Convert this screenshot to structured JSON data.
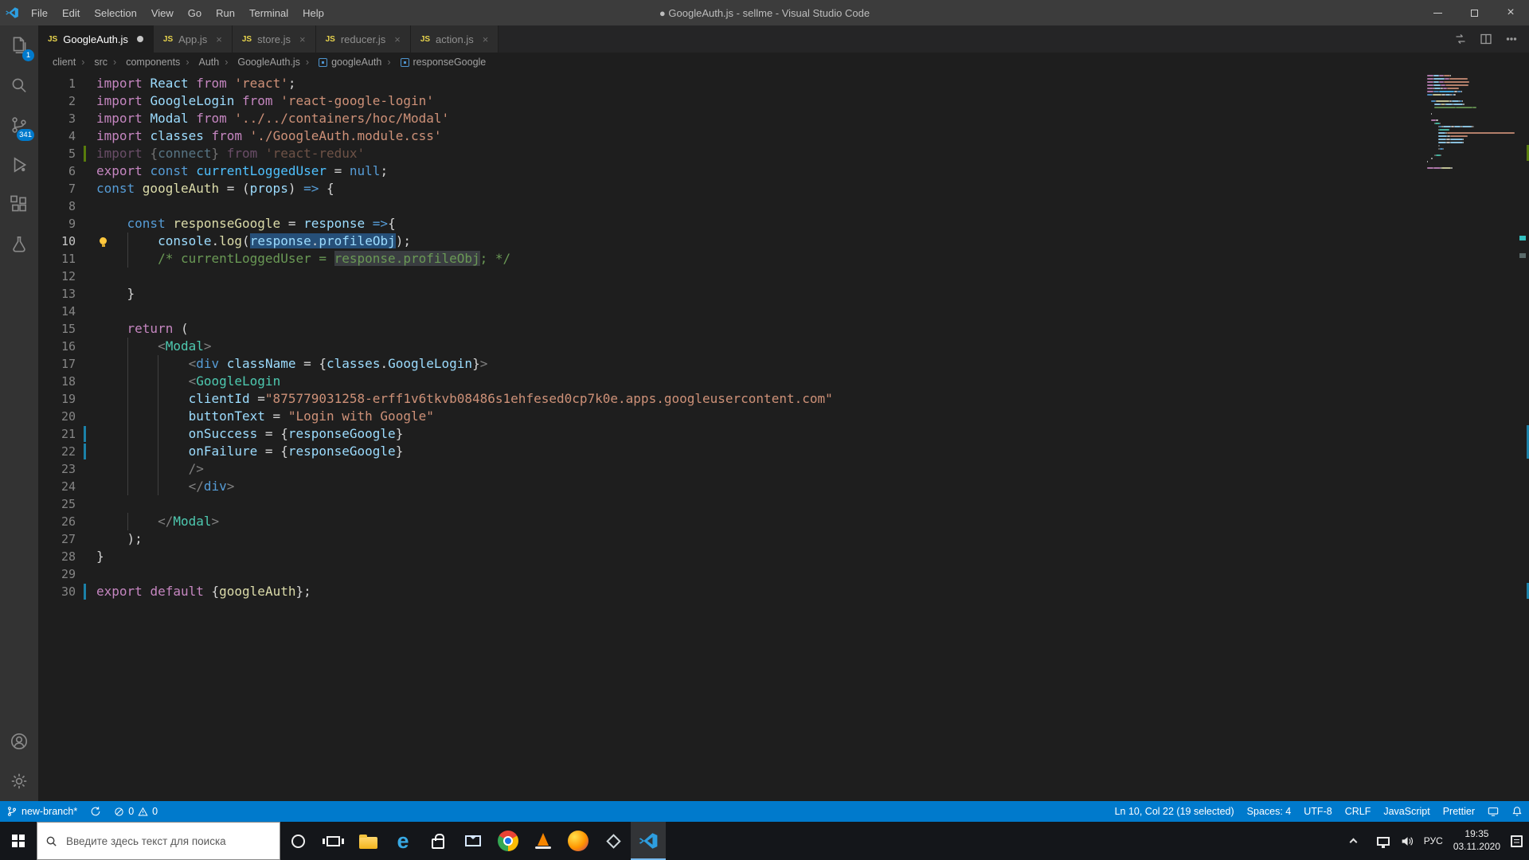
{
  "colors": {
    "accent": "#007acc",
    "selection": "#264f78",
    "match": "#3a3d41",
    "gut_mod": "#1b81a8",
    "gut_add": "#587c0c"
  },
  "titlebar": {
    "title": "● GoogleAuth.js - sellme - Visual Studio Code",
    "menus": [
      "File",
      "Edit",
      "Selection",
      "View",
      "Go",
      "Run",
      "Terminal",
      "Help"
    ]
  },
  "activitybar": {
    "explorer_badge": "1",
    "scm_badge": "341"
  },
  "tab_icon_text": "JS",
  "tabs": [
    {
      "label": "GoogleAuth.js"
    },
    {
      "label": "App.js"
    },
    {
      "label": "store.js"
    },
    {
      "label": "reducer.js"
    },
    {
      "label": "action.js"
    }
  ],
  "breadcrumb": {
    "items": [
      "client",
      "src",
      "components",
      "Auth",
      "GoogleAuth.js",
      "googleAuth",
      "responseGoogle"
    ]
  },
  "editor": {
    "palette": {
      "k": "#c586c0",
      "b": "#569cd6",
      "v": "#9cdcfe",
      "V": "#4fc1ff",
      "s": "#ce9178",
      "f": "#dcdcaa",
      "c": "#6a9955",
      "t": "#4ec9b0",
      "p": "#d4d4d4",
      "a": "#808080"
    },
    "lines": [
      {
        "t": [
          [
            "k",
            "import "
          ],
          [
            "v",
            "React "
          ],
          [
            "k",
            "from "
          ],
          [
            "s",
            "'react'"
          ],
          [
            "p",
            ";"
          ]
        ]
      },
      {
        "t": [
          [
            "k",
            "import "
          ],
          [
            "v",
            "GoogleLogin "
          ],
          [
            "k",
            "from "
          ],
          [
            "s",
            "'react-google-login'"
          ]
        ]
      },
      {
        "t": [
          [
            "k",
            "import "
          ],
          [
            "v",
            "Modal "
          ],
          [
            "k",
            "from "
          ],
          [
            "s",
            "'../../containers/hoc/Modal'"
          ]
        ]
      },
      {
        "t": [
          [
            "k",
            "import "
          ],
          [
            "v",
            "classes "
          ],
          [
            "k",
            "from "
          ],
          [
            "s",
            "'./GoogleAuth.module.css'"
          ]
        ]
      },
      {
        "d": true,
        "g": "a",
        "t": [
          [
            "k",
            "import "
          ],
          [
            "p",
            "{"
          ],
          [
            "v",
            "connect"
          ],
          [
            "p",
            "} "
          ],
          [
            "k",
            "from "
          ],
          [
            "s",
            "'react-redux'"
          ]
        ]
      },
      {
        "t": [
          [
            "k",
            "export "
          ],
          [
            "b",
            "const "
          ],
          [
            "V",
            "currentLoggedUser"
          ],
          [
            "p",
            " = "
          ],
          [
            "b",
            "null"
          ],
          [
            "p",
            ";"
          ]
        ]
      },
      {
        "t": [
          [
            "b",
            "const "
          ],
          [
            "f",
            "googleAuth"
          ],
          [
            "p",
            " = ("
          ],
          [
            "v",
            "props"
          ],
          [
            "p",
            ") "
          ],
          [
            "b",
            "=>"
          ],
          [
            "p",
            " {"
          ]
        ]
      },
      {
        "t": []
      },
      {
        "t": [
          [
            "i",
            "    "
          ],
          [
            "b",
            "const "
          ],
          [
            "f",
            "responseGoogle"
          ],
          [
            "p",
            " = "
          ],
          [
            "v",
            "response"
          ],
          [
            "p",
            " "
          ],
          [
            "b",
            "=>"
          ],
          [
            "p",
            "{"
          ]
        ]
      },
      {
        "cur": true,
        "lb": true,
        "t": [
          [
            "i",
            "    "
          ],
          [
            "i",
            "    "
          ],
          [
            "v",
            "console"
          ],
          [
            "p",
            "."
          ],
          [
            "f",
            "log"
          ],
          [
            "p",
            "("
          ],
          [
            "v",
            "response",
            "sel"
          ],
          [
            "p",
            ".",
            "sel"
          ],
          [
            "v",
            "profileObj",
            "sel"
          ],
          [
            "p",
            ");"
          ]
        ]
      },
      {
        "t": [
          [
            "i",
            "    "
          ],
          [
            "i",
            "    "
          ],
          [
            "c",
            "/* currentLoggedUser = "
          ],
          [
            "c",
            "response.profileObj",
            "hl"
          ],
          [
            "c",
            "; */"
          ]
        ]
      },
      {
        "t": []
      },
      {
        "t": [
          [
            "i",
            "    "
          ],
          [
            "p",
            "}"
          ]
        ]
      },
      {
        "t": []
      },
      {
        "t": [
          [
            "i",
            "    "
          ],
          [
            "k",
            "return"
          ],
          [
            "p",
            " ("
          ]
        ]
      },
      {
        "t": [
          [
            "i",
            "    "
          ],
          [
            "i",
            "    "
          ],
          [
            "a",
            "<"
          ],
          [
            "t",
            "Modal"
          ],
          [
            "a",
            ">"
          ]
        ]
      },
      {
        "t": [
          [
            "i",
            "    "
          ],
          [
            "i",
            "    "
          ],
          [
            "i",
            "    "
          ],
          [
            "a",
            "<"
          ],
          [
            "b",
            "div"
          ],
          [
            "p",
            " "
          ],
          [
            "v",
            "className"
          ],
          [
            "p",
            " = {"
          ],
          [
            "v",
            "classes"
          ],
          [
            "p",
            "."
          ],
          [
            "v",
            "GoogleLogin"
          ],
          [
            "p",
            "}"
          ],
          [
            "a",
            ">"
          ]
        ]
      },
      {
        "t": [
          [
            "i",
            "    "
          ],
          [
            "i",
            "    "
          ],
          [
            "i",
            "    "
          ],
          [
            "a",
            "<"
          ],
          [
            "t",
            "GoogleLogin"
          ]
        ]
      },
      {
        "t": [
          [
            "i",
            "    "
          ],
          [
            "i",
            "    "
          ],
          [
            "i",
            "    "
          ],
          [
            "v",
            "clientId"
          ],
          [
            "p",
            " ="
          ],
          [
            "s",
            "\"875779031258-erff1v6tkvb08486s1ehfesed0cp7k0e.apps.googleusercontent.com\""
          ]
        ]
      },
      {
        "t": [
          [
            "i",
            "    "
          ],
          [
            "i",
            "    "
          ],
          [
            "i",
            "    "
          ],
          [
            "v",
            "buttonText"
          ],
          [
            "p",
            " = "
          ],
          [
            "s",
            "\"Login with Google\""
          ]
        ]
      },
      {
        "g": "m",
        "t": [
          [
            "i",
            "    "
          ],
          [
            "i",
            "    "
          ],
          [
            "i",
            "    "
          ],
          [
            "v",
            "onSuccess"
          ],
          [
            "p",
            " = {"
          ],
          [
            "v",
            "responseGoogle"
          ],
          [
            "p",
            "}"
          ]
        ]
      },
      {
        "g": "m",
        "t": [
          [
            "i",
            "    "
          ],
          [
            "i",
            "    "
          ],
          [
            "i",
            "    "
          ],
          [
            "v",
            "onFailure"
          ],
          [
            "p",
            " = {"
          ],
          [
            "v",
            "responseGoogle"
          ],
          [
            "p",
            "}"
          ]
        ]
      },
      {
        "t": [
          [
            "i",
            "    "
          ],
          [
            "i",
            "    "
          ],
          [
            "i",
            "    "
          ],
          [
            "a",
            "/>"
          ]
        ]
      },
      {
        "t": [
          [
            "i",
            "    "
          ],
          [
            "i",
            "    "
          ],
          [
            "i",
            "    "
          ],
          [
            "a",
            "</"
          ],
          [
            "b",
            "div"
          ],
          [
            "a",
            ">"
          ]
        ]
      },
      {
        "t": []
      },
      {
        "t": [
          [
            "i",
            "    "
          ],
          [
            "i",
            "    "
          ],
          [
            "a",
            "</"
          ],
          [
            "t",
            "Modal"
          ],
          [
            "a",
            ">"
          ]
        ]
      },
      {
        "t": [
          [
            "i",
            "    "
          ],
          [
            "p",
            ");"
          ]
        ]
      },
      {
        "t": [
          [
            "p",
            "}"
          ]
        ]
      },
      {
        "t": []
      },
      {
        "g": "m",
        "t": [
          [
            "k",
            "export "
          ],
          [
            "k",
            "default "
          ],
          [
            "p",
            "{"
          ],
          [
            "f",
            "googleAuth"
          ],
          [
            "p",
            "};"
          ]
        ]
      }
    ]
  },
  "statusbar": {
    "branch": "new-branch*",
    "errors": "0",
    "warnings": "0",
    "position": "Ln 10, Col 22 (19 selected)",
    "spaces": "Spaces: 4",
    "encoding": "UTF-8",
    "eol": "CRLF",
    "language": "JavaScript",
    "formatter": "Prettier"
  },
  "taskbar": {
    "search_placeholder": "Введите здесь текст для поиска",
    "lang": "РУС",
    "time": "19:35",
    "date": "03.11.2020"
  }
}
